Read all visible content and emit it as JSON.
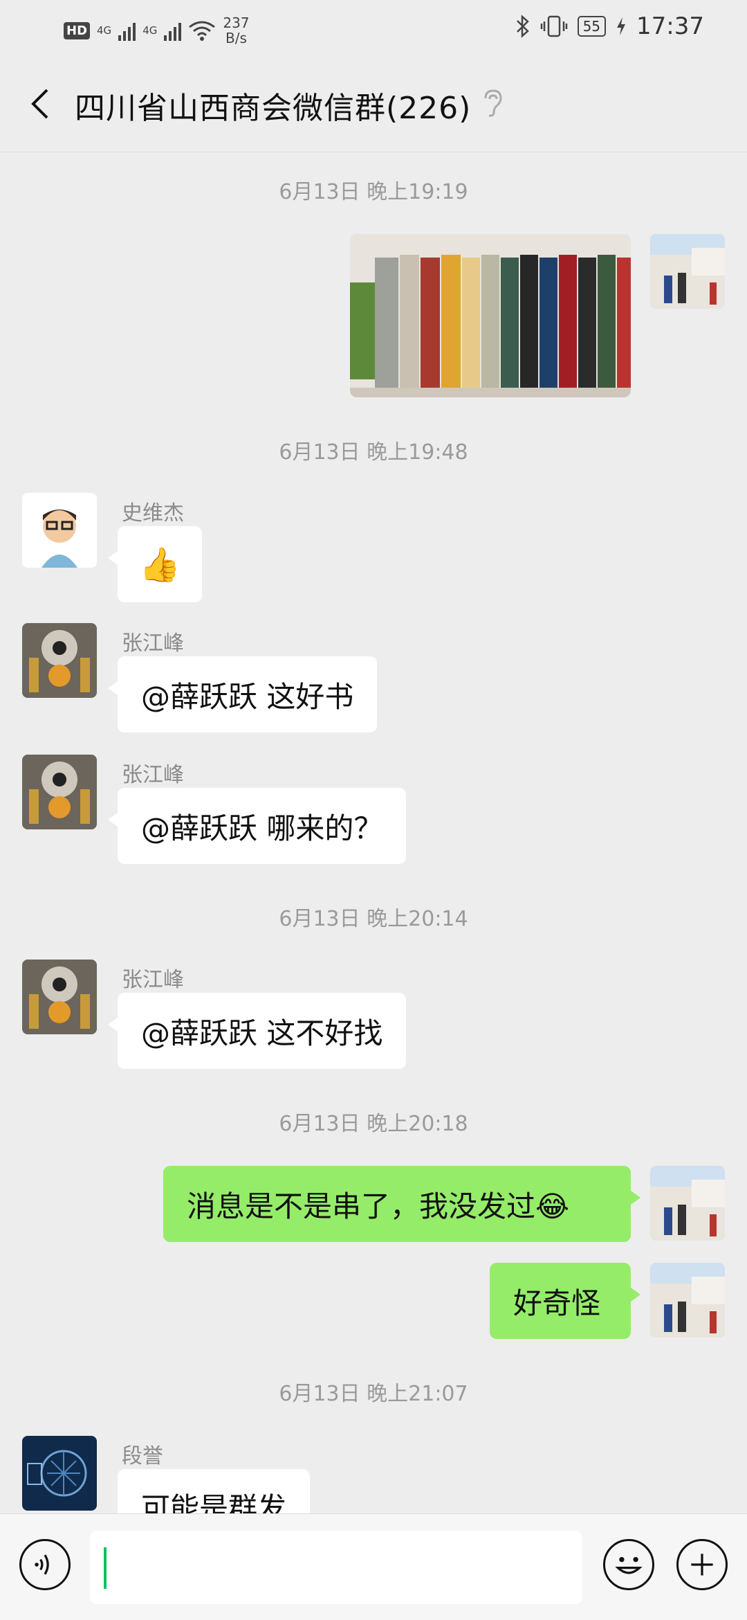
{
  "status_bar": {
    "hd": "HD",
    "network1": "4G",
    "network2": "4G",
    "speed_value": "237",
    "speed_unit": "B/s",
    "battery": "55",
    "time": "17:37"
  },
  "header": {
    "title": "四川省山西商会微信群(226)"
  },
  "timestamps": {
    "t1": "6月13日 晚上19:19",
    "t2": "6月13日 晚上19:48",
    "t3": "6月13日 晚上20:14",
    "t4": "6月13日 晚上20:18",
    "t5": "6月13日 晚上21:07"
  },
  "messages": {
    "m1_name": "史维杰",
    "m1_text": "👍",
    "m2_name": "张江峰",
    "m2_text": "@薛跃跃  这好书",
    "m3_name": "张江峰",
    "m3_text": "@薛跃跃  哪来的？",
    "m4_name": "张江峰",
    "m4_text": "@薛跃跃  这不好找",
    "m5_text": "消息是不是串了，我没发过😂",
    "m6_text": "好奇怪",
    "m7_name": "段誉",
    "m7_text": "可能是群发"
  },
  "colors": {
    "accent": "#07c160",
    "my_bubble": "#95ec69",
    "background": "#ededed"
  },
  "icons": [
    "back-arrow-icon",
    "ear-icon",
    "voice-icon",
    "emoji-icon",
    "plus-icon",
    "bluetooth-icon",
    "vibrate-icon",
    "wifi-icon",
    "battery-icon"
  ]
}
